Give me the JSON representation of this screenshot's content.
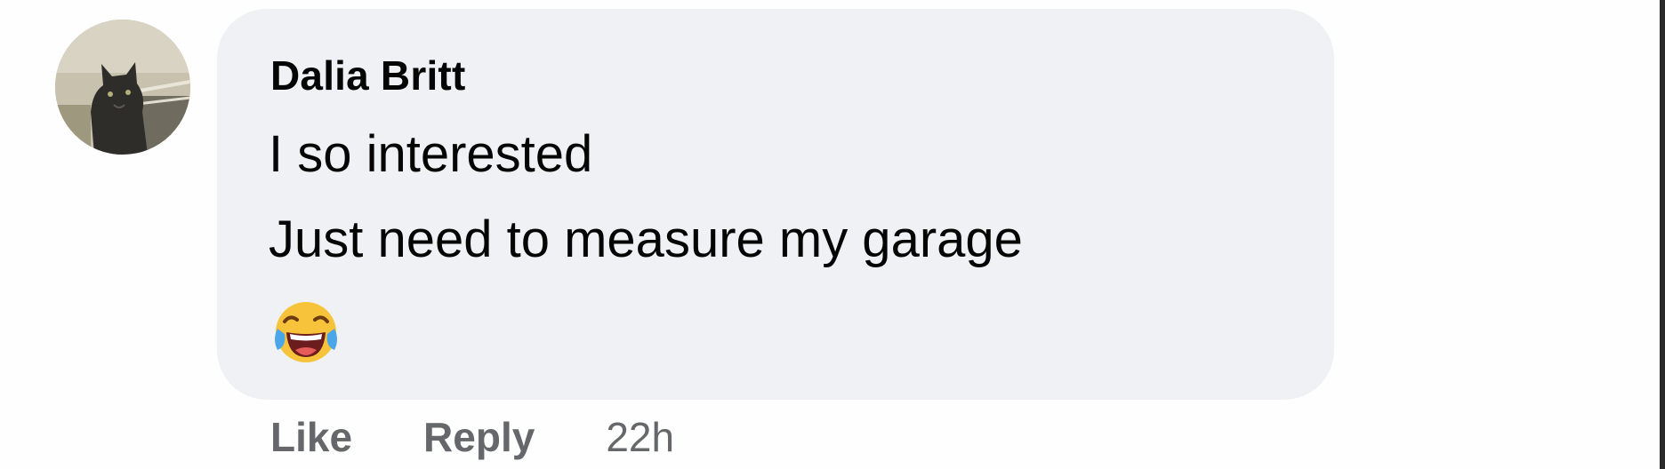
{
  "comment": {
    "author": "Dalia Britt",
    "lines": [
      "I so interested",
      "Just need to measure my garage"
    ],
    "emoji": "face-with-tears-of-joy",
    "actions": {
      "like_label": "Like",
      "reply_label": "Reply",
      "timestamp": "22h"
    }
  },
  "colors": {
    "bubble": "#f0f1f4",
    "text": "#050505",
    "secondary_text": "#65676b",
    "emoji_yellow": "#f7c33b",
    "emoji_tears": "#4aa6e8"
  }
}
